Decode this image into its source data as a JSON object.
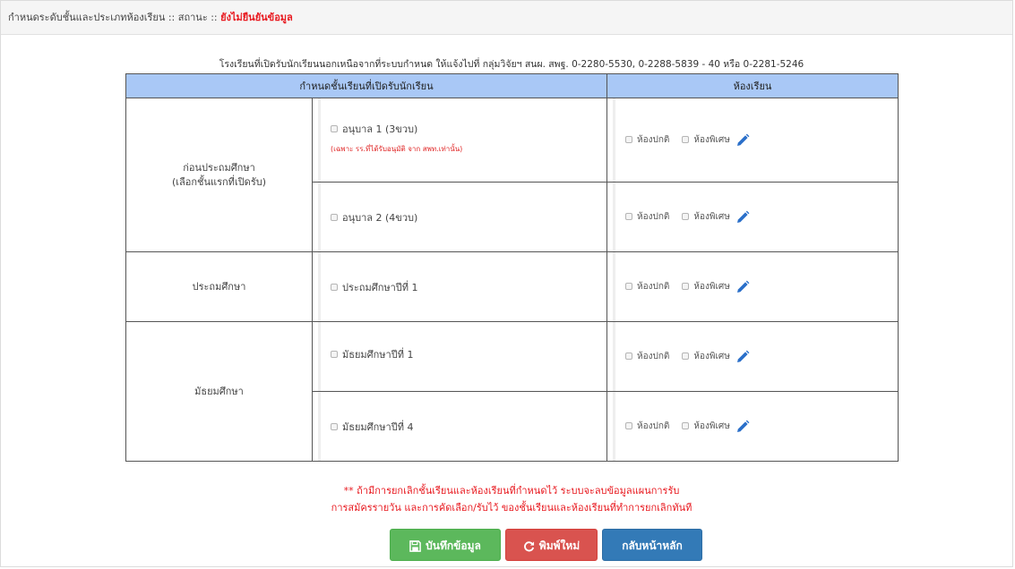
{
  "header": {
    "title": "กำหนดระดับชั้นและประเภทห้องเรียน",
    "separator1": " :: ",
    "status_label": "สถานะ",
    "separator2": " :: ",
    "status_value": "ยังไม่ยืนยันข้อมูล"
  },
  "note_top": "โรงเรียนที่เปิดรับนักเรียนนอกเหนือจากที่ระบบกำหนด ให้แจ้งไปที่ กลุ่มวิจัยฯ สนผ. สพฐ. 0-2280-5530, 0-2288-5839 - 40 หรือ 0-2281-5246",
  "table": {
    "col1_header": "กำหนดชั้นเรียนที่เปิดรับนักเรียน",
    "col2_header": "ห้องเรียน",
    "room_normal": "ห้องปกติ",
    "room_special": "ห้องพิเศษ",
    "groups": [
      {
        "level_line1": "ก่อนประถมศึกษา",
        "level_line2": "(เลือกชั้นแรกที่เปิดรับ)",
        "classes": [
          {
            "label": "อนุบาล 1 (3ขวบ)",
            "note": "(เฉพาะ รร.ที่ได้รับอนุมัติ จาก สพท.เท่านั้น)"
          },
          {
            "label": "อนุบาล 2 (4ขวบ)"
          }
        ]
      },
      {
        "level_line1": "ประถมศึกษา",
        "classes": [
          {
            "label": "ประถมศึกษาปีที่ 1"
          }
        ]
      },
      {
        "level_line1": "มัธยมศึกษา",
        "classes": [
          {
            "label": "มัธยมศึกษาปีที่ 1"
          },
          {
            "label": "มัธยมศึกษาปีที่ 4"
          }
        ]
      }
    ]
  },
  "warning": {
    "line1": "** ถ้ามีการยกเลิกชั้นเรียนและห้องเรียนที่กำหนดไว้ ระบบจะลบข้อมูลแผนการรับ",
    "line2": "การสมัครรายวัน และการคัดเลือก/รับไว้ ของชั้นเรียนและห้องเรียนที่ทำการยกเลิกทันที"
  },
  "buttons": {
    "save": "บันทึกข้อมูล",
    "reset": "พิมพ์ใหม่",
    "home": "กลับหน้าหลัก"
  },
  "colors": {
    "table_header_bg": "#a9c8f6",
    "status_red": "#e8191f",
    "save_green": "#5cb85c",
    "reset_red": "#d9534f",
    "home_blue": "#337ab7",
    "edit_icon_blue": "#2a6fc9"
  },
  "icons": {
    "edit": "pencil-icon",
    "save": "floppy-disk-icon",
    "reset": "refresh-icon"
  }
}
